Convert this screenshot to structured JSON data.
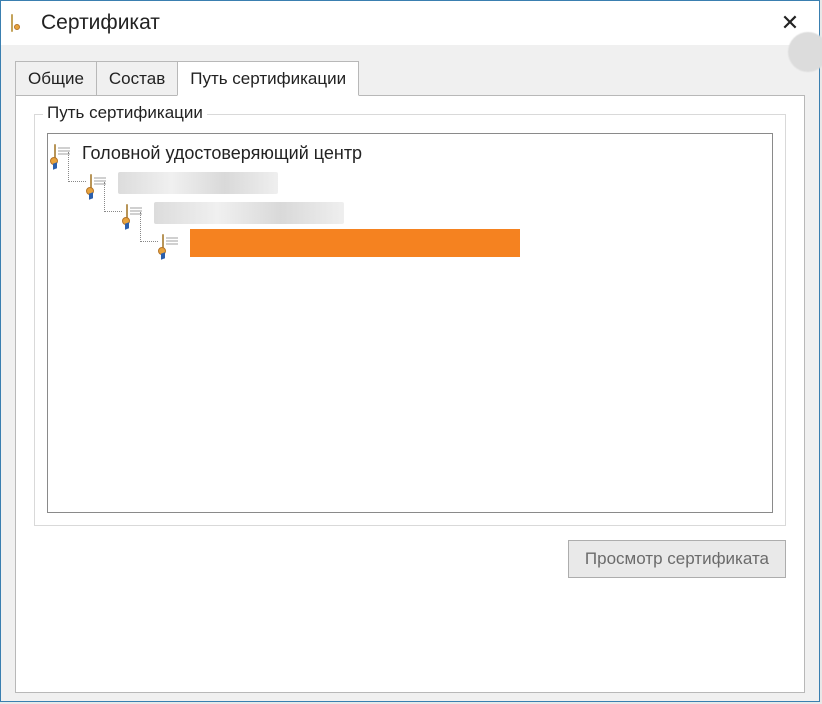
{
  "window": {
    "title": "Сертификат"
  },
  "tabs": [
    {
      "label": "Общие"
    },
    {
      "label": "Состав"
    },
    {
      "label": "Путь сертификации"
    }
  ],
  "active_tab_index": 2,
  "groupbox": {
    "label": "Путь сертификации"
  },
  "tree": [
    {
      "level": 0,
      "label": "Головной удостоверяющий центр"
    },
    {
      "level": 1,
      "label": ""
    },
    {
      "level": 2,
      "label": ""
    },
    {
      "level": 3,
      "label": ""
    }
  ],
  "buttons": {
    "view_cert": "Просмотр сертификата"
  }
}
